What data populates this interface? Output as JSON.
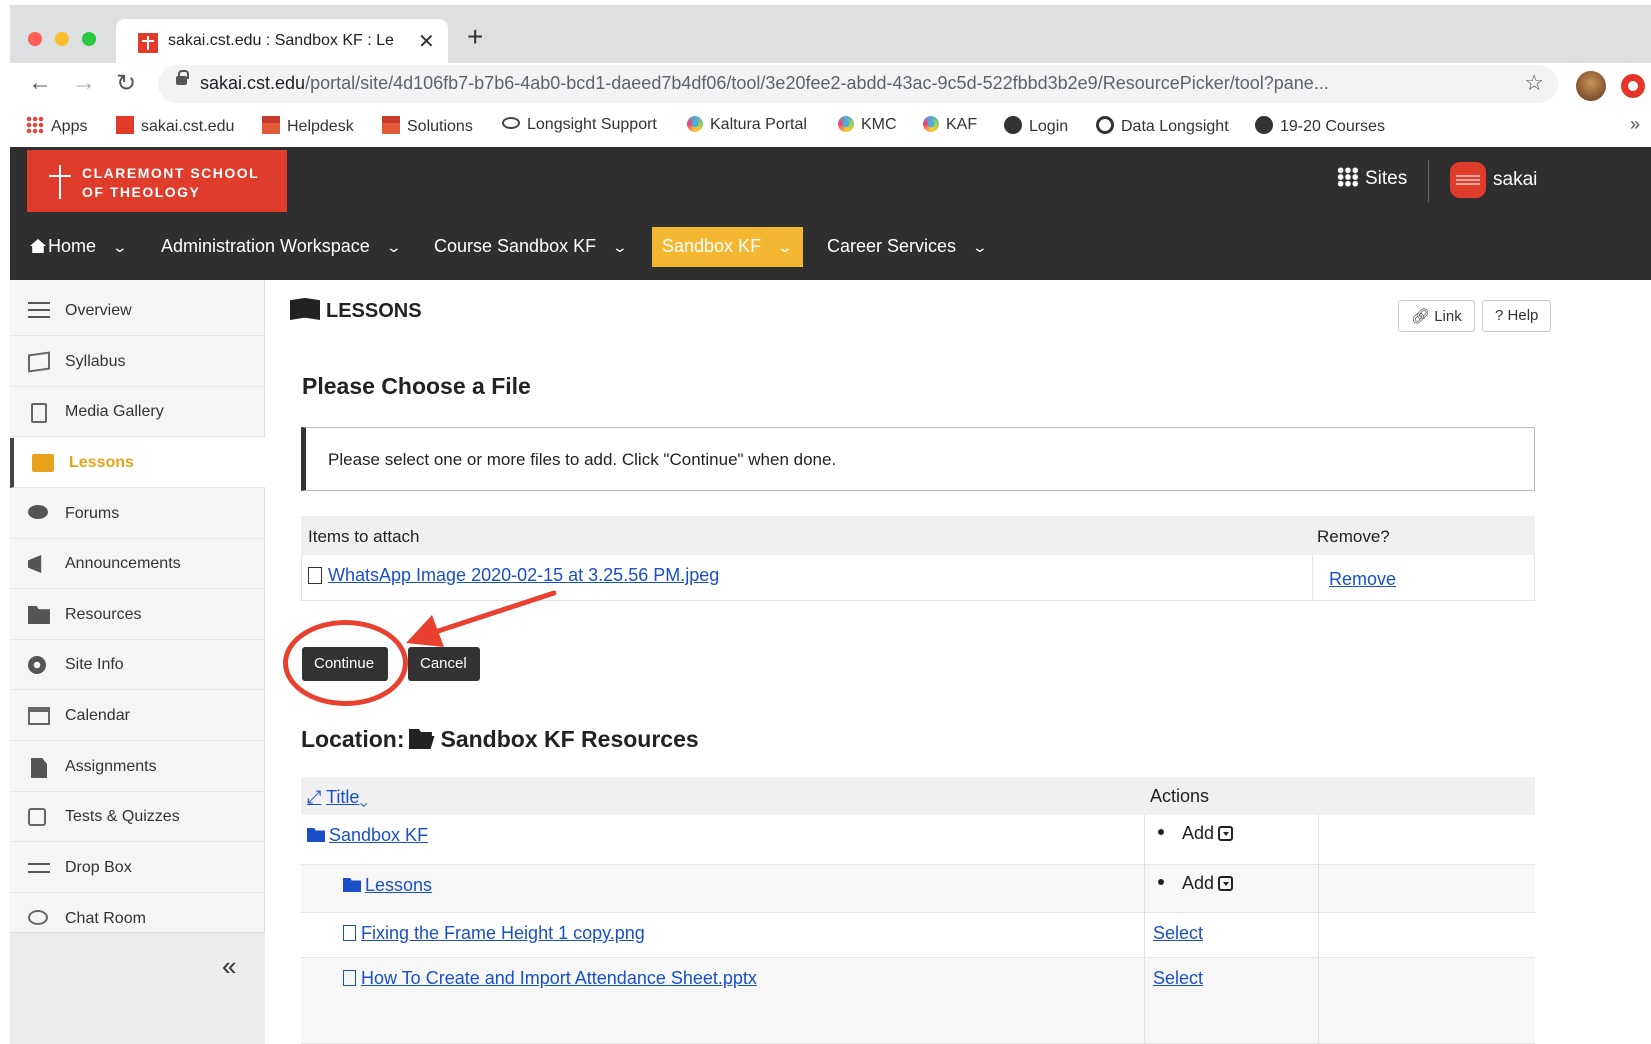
{
  "browser": {
    "tab_title": "sakai.cst.edu : Sandbox KF : Lessons",
    "url_host": "sakai.cst.edu",
    "url_path": "/portal/site/4d106fb7-b7b6-4ab0-bcd1-daeed7b4df06/tool/3e20fee2-abdd-43ac-9c5d-522fbbd3b2e9/ResourcePicker/tool?pane...",
    "bookmarks": [
      {
        "label": "Apps",
        "icon": "apps-grid-icon"
      },
      {
        "label": "sakai.cst.edu",
        "icon": "sakai-favicon-icon"
      },
      {
        "label": "Helpdesk",
        "icon": "helpdesk-favicon-icon"
      },
      {
        "label": "Solutions",
        "icon": "solutions-favicon-icon"
      },
      {
        "label": "Longsight Support",
        "icon": "eye-icon"
      },
      {
        "label": "Kaltura Portal",
        "icon": "kaltura-icon"
      },
      {
        "label": "KMC",
        "icon": "kaltura-icon"
      },
      {
        "label": "KAF",
        "icon": "kaltura-icon"
      },
      {
        "label": "Login",
        "icon": "globe-icon"
      },
      {
        "label": "Data Longsight",
        "icon": "dl-icon"
      },
      {
        "label": "19-20 Courses",
        "icon": "globe-icon"
      }
    ],
    "more": "»"
  },
  "header": {
    "logo_text": "CLAREMONT SCHOOL\nOF THEOLOGY",
    "sites_label": "Sites",
    "user_label": "sakai",
    "site_tabs": [
      "Home",
      "Administration Workspace",
      "Course Sandbox KF",
      "Sandbox KF",
      "Career Services"
    ],
    "active_site": "Sandbox KF",
    "accent_color": "#f4b731"
  },
  "sidebar": {
    "items": [
      {
        "label": "Overview"
      },
      {
        "label": "Syllabus"
      },
      {
        "label": "Media Gallery"
      },
      {
        "label": "Lessons"
      },
      {
        "label": "Forums"
      },
      {
        "label": "Announcements"
      },
      {
        "label": "Resources"
      },
      {
        "label": "Site Info"
      },
      {
        "label": "Calendar"
      },
      {
        "label": "Assignments"
      },
      {
        "label": "Tests & Quizzes"
      },
      {
        "label": "Drop Box"
      },
      {
        "label": "Chat Room"
      }
    ],
    "active": "Lessons",
    "collapse_label": "«"
  },
  "main": {
    "tool_title": "LESSONS",
    "link_btn": "Link",
    "help_btn": "Help",
    "heading": "Please Choose a File",
    "instruction": "Please select one or more files to add. Click \"Continue\" when done.",
    "attach": {
      "col1": "Items to attach",
      "col2": "Remove?",
      "file": "WhatsApp Image 2020-02-15 at 3.25.56 PM.jpeg",
      "remove": "Remove"
    },
    "continue_btn": "Continue",
    "cancel_btn": "Cancel",
    "location_label": "Location:",
    "location_name": "Sandbox KF Resources",
    "resources": {
      "col_title": "Title",
      "col_actions": "Actions",
      "rows": [
        {
          "name": "Sandbox KF",
          "action": "Add"
        },
        {
          "name": "Lessons",
          "action": "Add"
        },
        {
          "name": "Fixing the Frame Height 1 copy.png",
          "action": "Select"
        },
        {
          "name": "How To Create and Import Attendance Sheet.pptx",
          "action": "Select"
        }
      ]
    }
  }
}
